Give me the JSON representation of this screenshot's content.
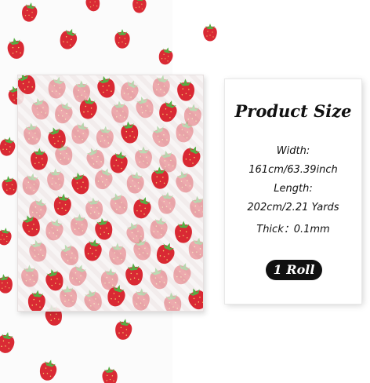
{
  "product_card": {
    "title": "Product Size",
    "specs": [
      "Width:",
      "161cm/63.39inch",
      "Length:",
      "202cm/2.21 Yards",
      "Thick：0.1mm"
    ],
    "quantity_badge": "1 Roll"
  },
  "colors": {
    "strawberry_red": "#d81f2a",
    "strawberry_leaf": "#4faa3c",
    "badge_background": "#111111"
  }
}
